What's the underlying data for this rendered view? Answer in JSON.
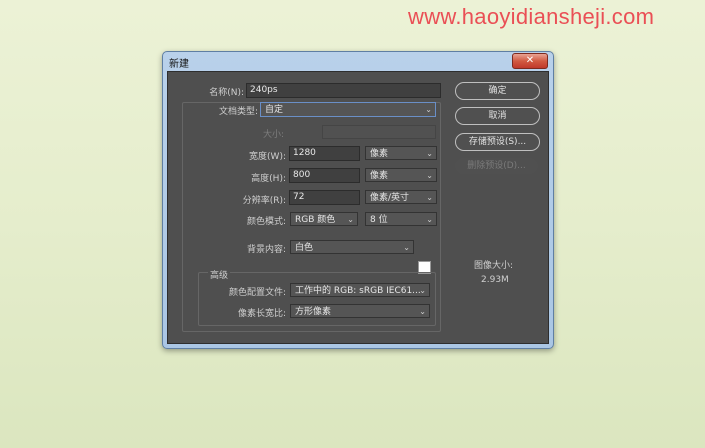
{
  "watermark": "www.haoyidiansheji.com",
  "window": {
    "title": "新建",
    "close_glyph": "✕"
  },
  "form": {
    "name": {
      "label": "名称(N):",
      "value": "240ps"
    },
    "document_type": {
      "label": "文档类型:",
      "value": "自定"
    },
    "size": {
      "label": "大小:",
      "value": ""
    },
    "width": {
      "label": "宽度(W):",
      "value": "1280",
      "unit": "像素"
    },
    "height": {
      "label": "高度(H):",
      "value": "800",
      "unit": "像素"
    },
    "resolution": {
      "label": "分辨率(R):",
      "value": "72",
      "unit": "像素/英寸"
    },
    "color_mode": {
      "label": "颜色模式:",
      "value": "RGB 颜色",
      "depth": "8 位"
    },
    "background": {
      "label": "背景内容:",
      "value": "白色",
      "swatch_color": "#ffffff"
    },
    "advanced": {
      "title": "高级",
      "color_profile": {
        "label": "颜色配置文件:",
        "value": "工作中的 RGB: sRGB IEC61..."
      },
      "pixel_aspect": {
        "label": "像素长宽比:",
        "value": "方形像素"
      }
    }
  },
  "buttons": {
    "ok": "确定",
    "cancel": "取消",
    "save_preset": "存储预设(S)...",
    "delete_preset": "删除预设(D)..."
  },
  "image_size": {
    "label": "图像大小:",
    "value": "2.93M"
  },
  "colors": {
    "dialog_bg": "#4f4f4f",
    "title_bar": "#aac6e4",
    "close_button": "#c0392b",
    "watermark": "#ea4f55"
  },
  "icons": {
    "dropdown": "chevron-down-icon",
    "close": "close-icon"
  }
}
